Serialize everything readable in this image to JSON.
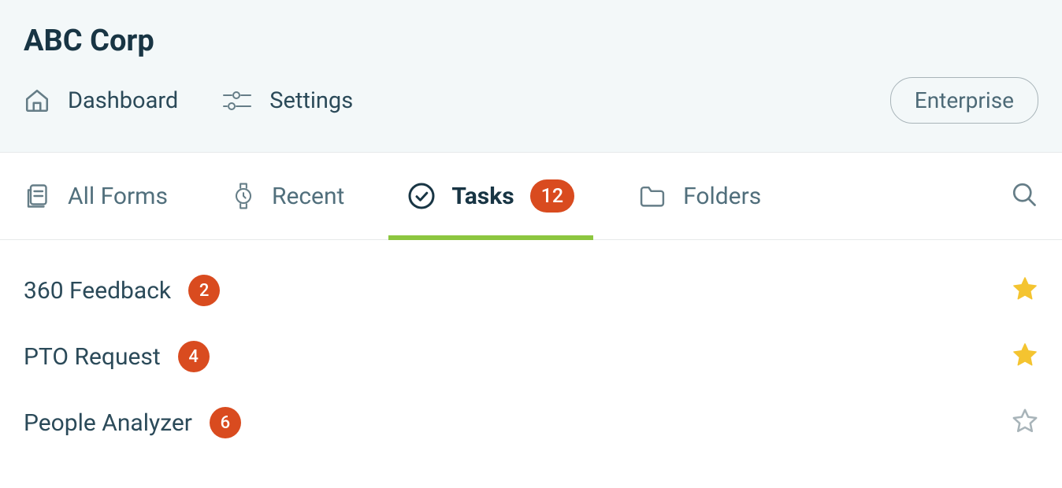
{
  "org_title": "ABC Corp",
  "nav": {
    "dashboard": "Dashboard",
    "settings": "Settings",
    "enterprise": "Enterprise"
  },
  "tabs": {
    "all_forms": "All Forms",
    "recent": "Recent",
    "tasks": "Tasks",
    "tasks_count": "12",
    "folders": "Folders"
  },
  "items": [
    {
      "title": "360 Feedback",
      "count": "2",
      "starred": true
    },
    {
      "title": "PTO Request",
      "count": "4",
      "starred": true
    },
    {
      "title": "People Analyzer",
      "count": "6",
      "starred": false
    }
  ]
}
